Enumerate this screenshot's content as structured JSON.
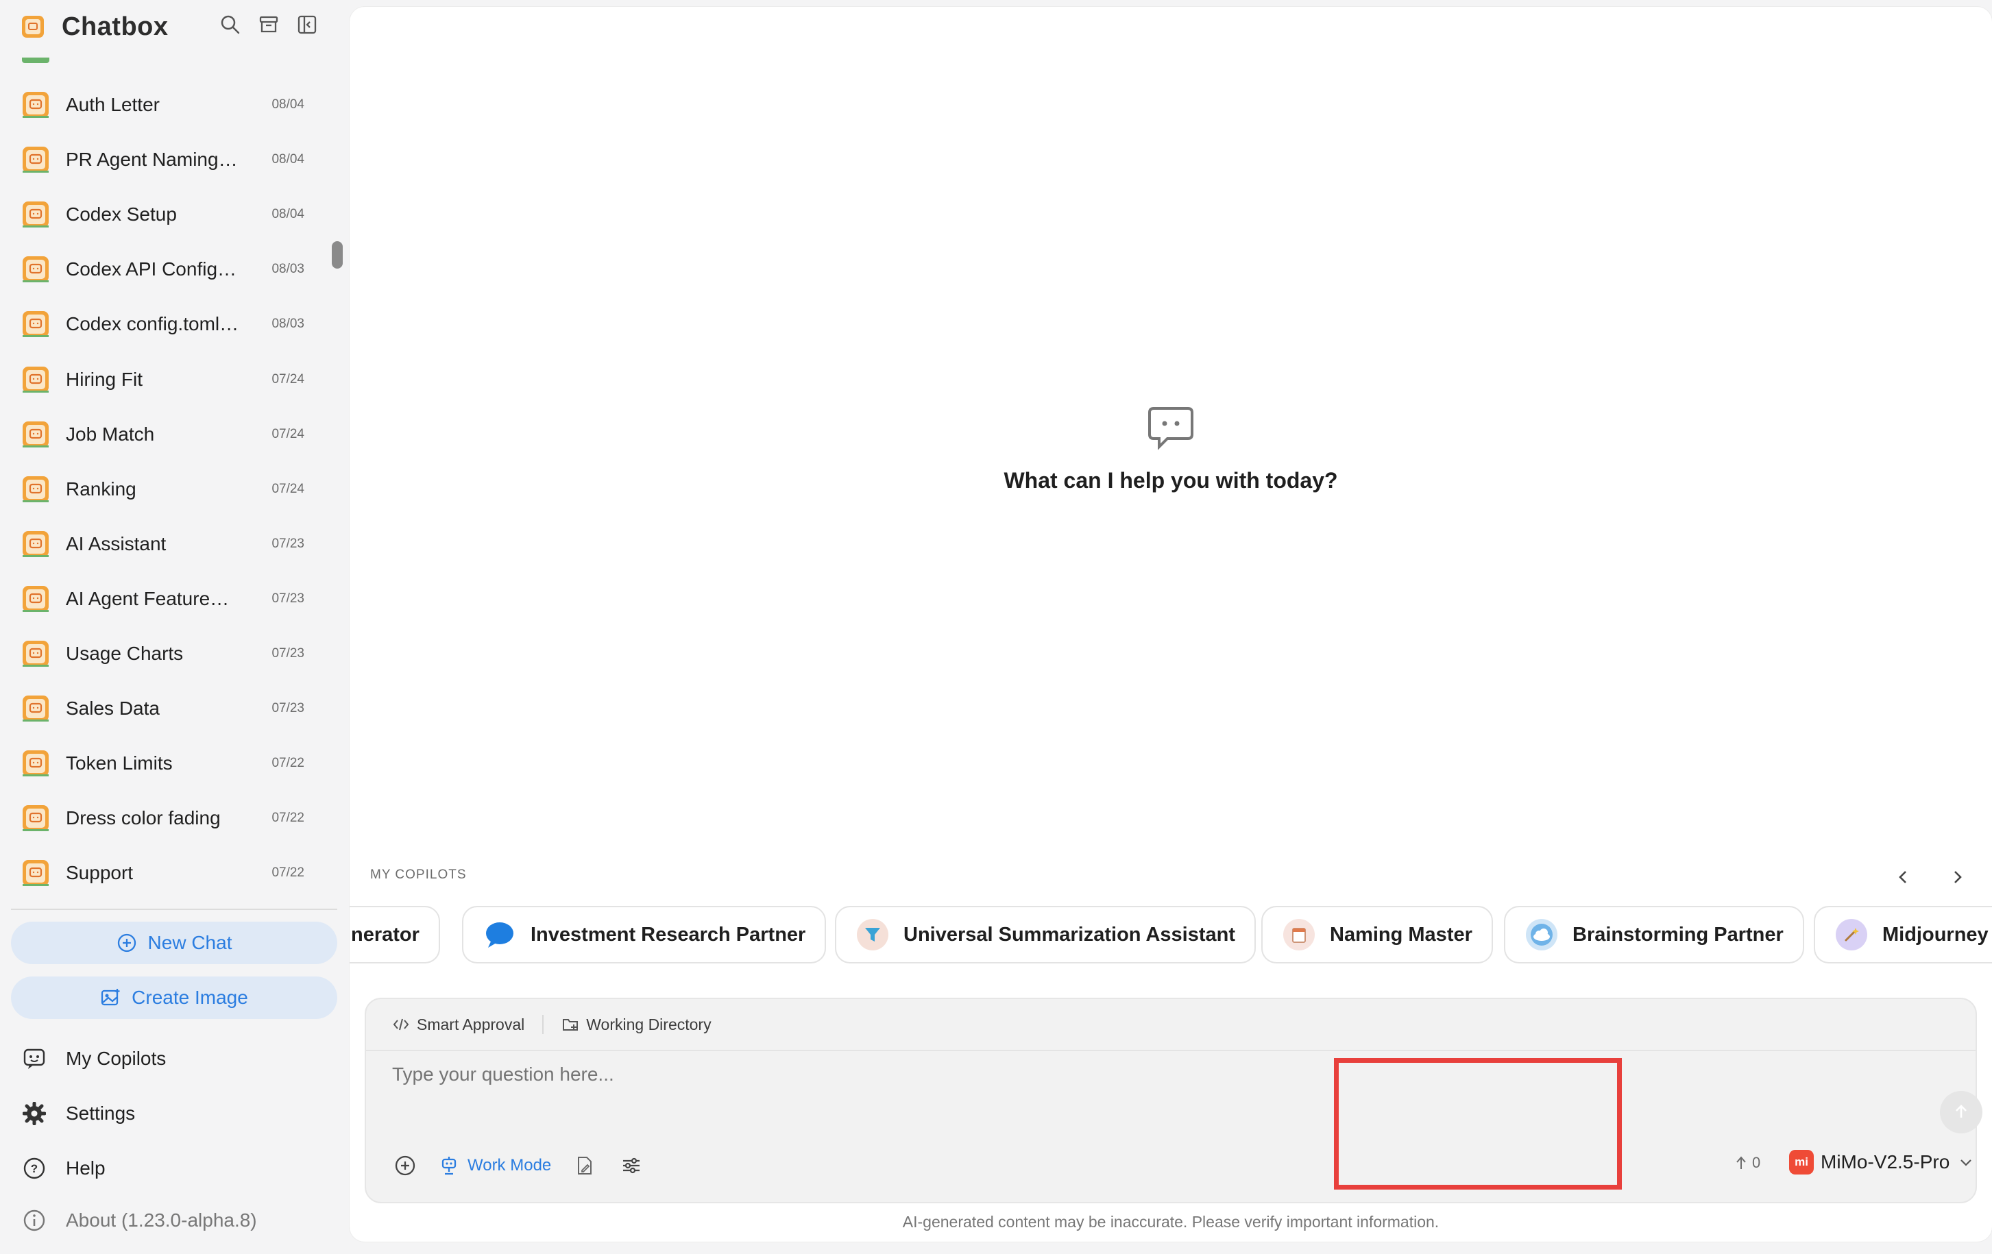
{
  "app": {
    "title": "Chatbox"
  },
  "chats": [
    {
      "title": "Auth Letter",
      "date": "08/04"
    },
    {
      "title": "PR Agent Naming…",
      "date": "08/04"
    },
    {
      "title": "Codex Setup",
      "date": "08/04"
    },
    {
      "title": "Codex API Config…",
      "date": "08/03"
    },
    {
      "title": "Codex config.toml…",
      "date": "08/03"
    },
    {
      "title": "Hiring Fit",
      "date": "07/24"
    },
    {
      "title": "Job Match",
      "date": "07/24"
    },
    {
      "title": "Ranking",
      "date": "07/24"
    },
    {
      "title": "AI Assistant",
      "date": "07/23"
    },
    {
      "title": "AI Agent Feature…",
      "date": "07/23"
    },
    {
      "title": "Usage Charts",
      "date": "07/23"
    },
    {
      "title": "Sales Data",
      "date": "07/23"
    },
    {
      "title": "Token Limits",
      "date": "07/22"
    },
    {
      "title": "Dress color fading",
      "date": "07/22"
    },
    {
      "title": "Support",
      "date": "07/22"
    }
  ],
  "sidebar": {
    "new_chat": "New Chat",
    "create_image": "Create Image",
    "my_copilots": "My Copilots",
    "settings": "Settings",
    "help": "Help",
    "about": "About (1.23.0-alpha.8)"
  },
  "main": {
    "headline": "What can I help you with today?",
    "copilots_label": "MY COPILOTS",
    "copilots": [
      {
        "name": "nerator",
        "icon": "generator-icon"
      },
      {
        "name": "Investment Research Partner",
        "icon": "speech-bubble-icon"
      },
      {
        "name": "Universal Summarization Assistant",
        "icon": "funnel-icon"
      },
      {
        "name": "Naming Master",
        "icon": "notepad-icon"
      },
      {
        "name": "Brainstorming Partner",
        "icon": "cloud-icon"
      },
      {
        "name": "Midjourney",
        "icon": "magic-wand-icon"
      }
    ]
  },
  "composer": {
    "smart_approval": "Smart Approval",
    "working_directory": "Working Directory",
    "placeholder": "Type your question here...",
    "work_mode": "Work Mode",
    "token_count": "0",
    "model_logo": "mi",
    "model": "MiMo-V2.5-Pro"
  },
  "disclaimer": "AI-generated content may be inaccurate. Please verify important information.",
  "colors": {
    "accent": "#2b7de0",
    "highlight": "#e8403c",
    "model_brand": "#ef4b36"
  }
}
